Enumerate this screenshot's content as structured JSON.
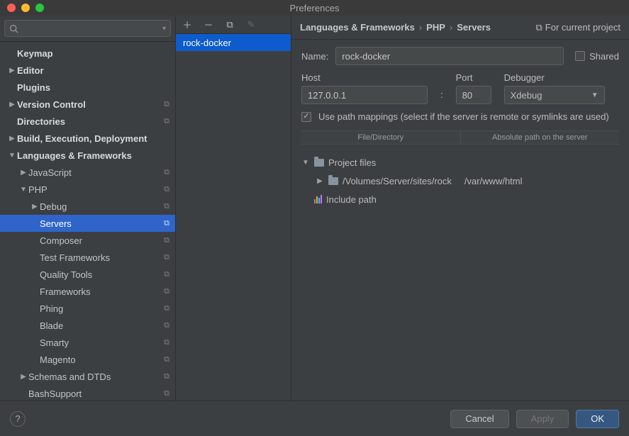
{
  "window_title": "Preferences",
  "search_placeholder": "",
  "sidebar": [
    {
      "label": "Keymap",
      "depth": 0,
      "arrow": "",
      "bold": true
    },
    {
      "label": "Editor",
      "depth": 0,
      "arrow": "▶",
      "bold": true
    },
    {
      "label": "Plugins",
      "depth": 0,
      "arrow": "",
      "bold": true
    },
    {
      "label": "Version Control",
      "depth": 0,
      "arrow": "▶",
      "bold": true,
      "scope": true
    },
    {
      "label": "Directories",
      "depth": 0,
      "arrow": "",
      "bold": true,
      "scope": true
    },
    {
      "label": "Build, Execution, Deployment",
      "depth": 0,
      "arrow": "▶",
      "bold": true
    },
    {
      "label": "Languages & Frameworks",
      "depth": 0,
      "arrow": "▼",
      "bold": true
    },
    {
      "label": "JavaScript",
      "depth": 1,
      "arrow": "▶",
      "scope": true
    },
    {
      "label": "PHP",
      "depth": 1,
      "arrow": "▼",
      "scope": true
    },
    {
      "label": "Debug",
      "depth": 2,
      "arrow": "▶",
      "scope": true
    },
    {
      "label": "Servers",
      "depth": 2,
      "arrow": "",
      "scope": true,
      "selected": true
    },
    {
      "label": "Composer",
      "depth": 2,
      "arrow": "",
      "scope": true
    },
    {
      "label": "Test Frameworks",
      "depth": 2,
      "arrow": "",
      "scope": true
    },
    {
      "label": "Quality Tools",
      "depth": 2,
      "arrow": "",
      "scope": true
    },
    {
      "label": "Frameworks",
      "depth": 2,
      "arrow": "",
      "scope": true
    },
    {
      "label": "Phing",
      "depth": 2,
      "arrow": "",
      "scope": true
    },
    {
      "label": "Blade",
      "depth": 2,
      "arrow": "",
      "scope": true
    },
    {
      "label": "Smarty",
      "depth": 2,
      "arrow": "",
      "scope": true
    },
    {
      "label": "Magento",
      "depth": 2,
      "arrow": "",
      "scope": true
    },
    {
      "label": "Schemas and DTDs",
      "depth": 1,
      "arrow": "▶",
      "scope": true
    },
    {
      "label": "BashSupport",
      "depth": 1,
      "arrow": "",
      "scope": true
    }
  ],
  "breadcrumb": [
    "Languages & Frameworks",
    "PHP",
    "Servers"
  ],
  "project_scope_label": "For current project",
  "server_list": [
    "rock-docker"
  ],
  "form": {
    "name_label": "Name:",
    "name_value": "rock-docker",
    "shared_label": "Shared",
    "host_label": "Host",
    "host_value": "127.0.0.1",
    "port_label": "Port",
    "port_value": "80",
    "debugger_label": "Debugger",
    "debugger_value": "Xdebug",
    "colon": ":",
    "use_mappings_label": "Use path mappings (select if the server is remote or symlinks are used)",
    "col_file": "File/Directory",
    "col_abs": "Absolute path on the server",
    "project_files_label": "Project files",
    "local_path": "/Volumes/Server/sites/rock",
    "remote_path": "/var/www/html",
    "include_path_label": "Include path"
  },
  "buttons": {
    "cancel": "Cancel",
    "apply": "Apply",
    "ok": "OK"
  }
}
